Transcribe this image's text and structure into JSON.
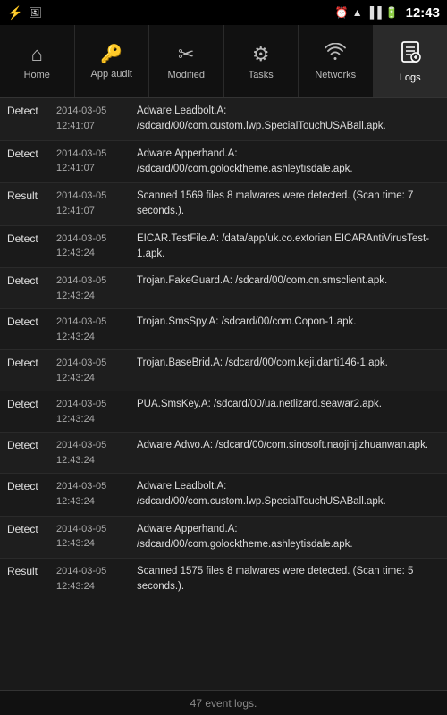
{
  "statusBar": {
    "time": "12:43",
    "icons": [
      "usb",
      "image",
      "alarm",
      "wifi",
      "signal",
      "battery"
    ]
  },
  "nav": {
    "items": [
      {
        "id": "home",
        "label": "Home",
        "icon": "home"
      },
      {
        "id": "app-audit",
        "label": "App audit",
        "icon": "key"
      },
      {
        "id": "modified",
        "label": "Modified",
        "icon": "scissors"
      },
      {
        "id": "tasks",
        "label": "Tasks",
        "icon": "gear"
      },
      {
        "id": "networks",
        "label": "Networks",
        "icon": "wifi"
      },
      {
        "id": "logs",
        "label": "Logs",
        "icon": "logs",
        "active": true
      }
    ]
  },
  "logs": [
    {
      "type": "Detect",
      "date": "2014-03-05",
      "time": "12:41:07",
      "description": "Adware.Leadbolt.A: /sdcard/00/com.custom.lwp.SpecialTouchUSABall.apk."
    },
    {
      "type": "Detect",
      "date": "2014-03-05",
      "time": "12:41:07",
      "description": "Adware.Apperhand.A: /sdcard/00/com.golocktheme.ashleytisdale.apk."
    },
    {
      "type": "Result",
      "date": "2014-03-05",
      "time": "12:41:07",
      "description": "Scanned 1569 files 8 malwares were detected. (Scan time: 7 seconds.)."
    },
    {
      "type": "Detect",
      "date": "2014-03-05",
      "time": "12:43:24",
      "description": "EICAR.TestFile.A: /data/app/uk.co.extorian.EICARAntiVirusTest-1.apk."
    },
    {
      "type": "Detect",
      "date": "2014-03-05",
      "time": "12:43:24",
      "description": "Trojan.FakeGuard.A: /sdcard/00/com.cn.smsclient.apk."
    },
    {
      "type": "Detect",
      "date": "2014-03-05",
      "time": "12:43:24",
      "description": "Trojan.SmsSpy.A: /sdcard/00/com.Copon-1.apk."
    },
    {
      "type": "Detect",
      "date": "2014-03-05",
      "time": "12:43:24",
      "description": "Trojan.BaseBrid.A: /sdcard/00/com.keji.danti146-1.apk."
    },
    {
      "type": "Detect",
      "date": "2014-03-05",
      "time": "12:43:24",
      "description": "PUA.SmsKey.A: /sdcard/00/ua.netlizard.seawar2.apk."
    },
    {
      "type": "Detect",
      "date": "2014-03-05",
      "time": "12:43:24",
      "description": "Adware.Adwo.A: /sdcard/00/com.sinosoft.naojinjizhuanwan.apk."
    },
    {
      "type": "Detect",
      "date": "2014-03-05",
      "time": "12:43:24",
      "description": "Adware.Leadbolt.A: /sdcard/00/com.custom.lwp.SpecialTouchUSABall.apk."
    },
    {
      "type": "Detect",
      "date": "2014-03-05",
      "time": "12:43:24",
      "description": "Adware.Apperhand.A: /sdcard/00/com.golocktheme.ashleytisdale.apk."
    },
    {
      "type": "Result",
      "date": "2014-03-05",
      "time": "12:43:24",
      "description": "Scanned 1575 files 8 malwares were detected. (Scan time: 5 seconds.)."
    }
  ],
  "footer": {
    "text": "47 event logs."
  }
}
